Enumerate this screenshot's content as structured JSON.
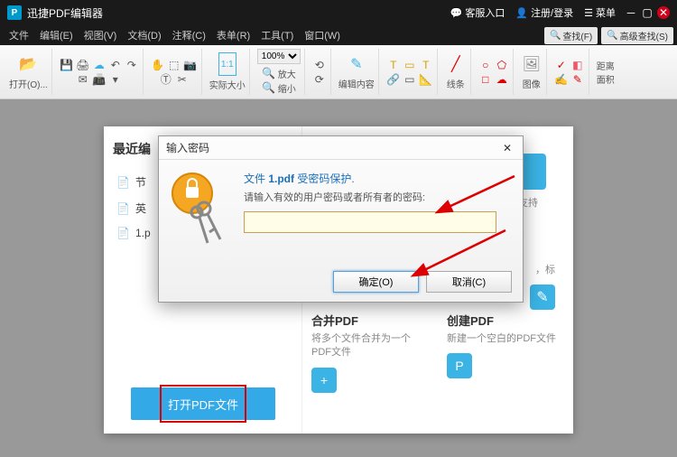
{
  "titlebar": {
    "app_name": "迅捷PDF编辑器",
    "service_entry": "客服入口",
    "register_login": "注册/登录",
    "menu": "菜单"
  },
  "menubar": {
    "file": "文件",
    "edit": "编辑(E)",
    "view": "视图(V)",
    "document": "文档(D)",
    "annotate": "注释(C)",
    "form": "表单(R)",
    "tools": "工具(T)",
    "window": "窗口(W)",
    "find": "查找(F)",
    "advanced_find": "高级查找(S)"
  },
  "toolbar": {
    "open": "打开(O)...",
    "zoom_pct": "100%",
    "zoom_in": "放大",
    "actual_size": "实际大小",
    "zoom_out": "缩小",
    "edit_content": "编辑内容",
    "lines": "线条",
    "image": "图像",
    "distance": "距离",
    "area": "面积"
  },
  "panel": {
    "recent_title": "最近编",
    "files": [
      "节",
      "英",
      "1.p"
    ],
    "open_pdf_btn": "打开PDF文件",
    "merge_title": "合并PDF",
    "merge_desc": "将多个文件合并为一个PDF文件",
    "create_title": "创建PDF",
    "create_desc": "新建一个空白的PDF文件",
    "support": "支持",
    "tag_note": "，标"
  },
  "dialog": {
    "title": "输入密码",
    "line1_pre": "文件 ",
    "line1_file": "1.pdf",
    "line1_post": " 受密码保护.",
    "line2": "请输入有效的用户密码或者所有者的密码:",
    "ok": "确定(O)",
    "cancel": "取消(C)"
  }
}
